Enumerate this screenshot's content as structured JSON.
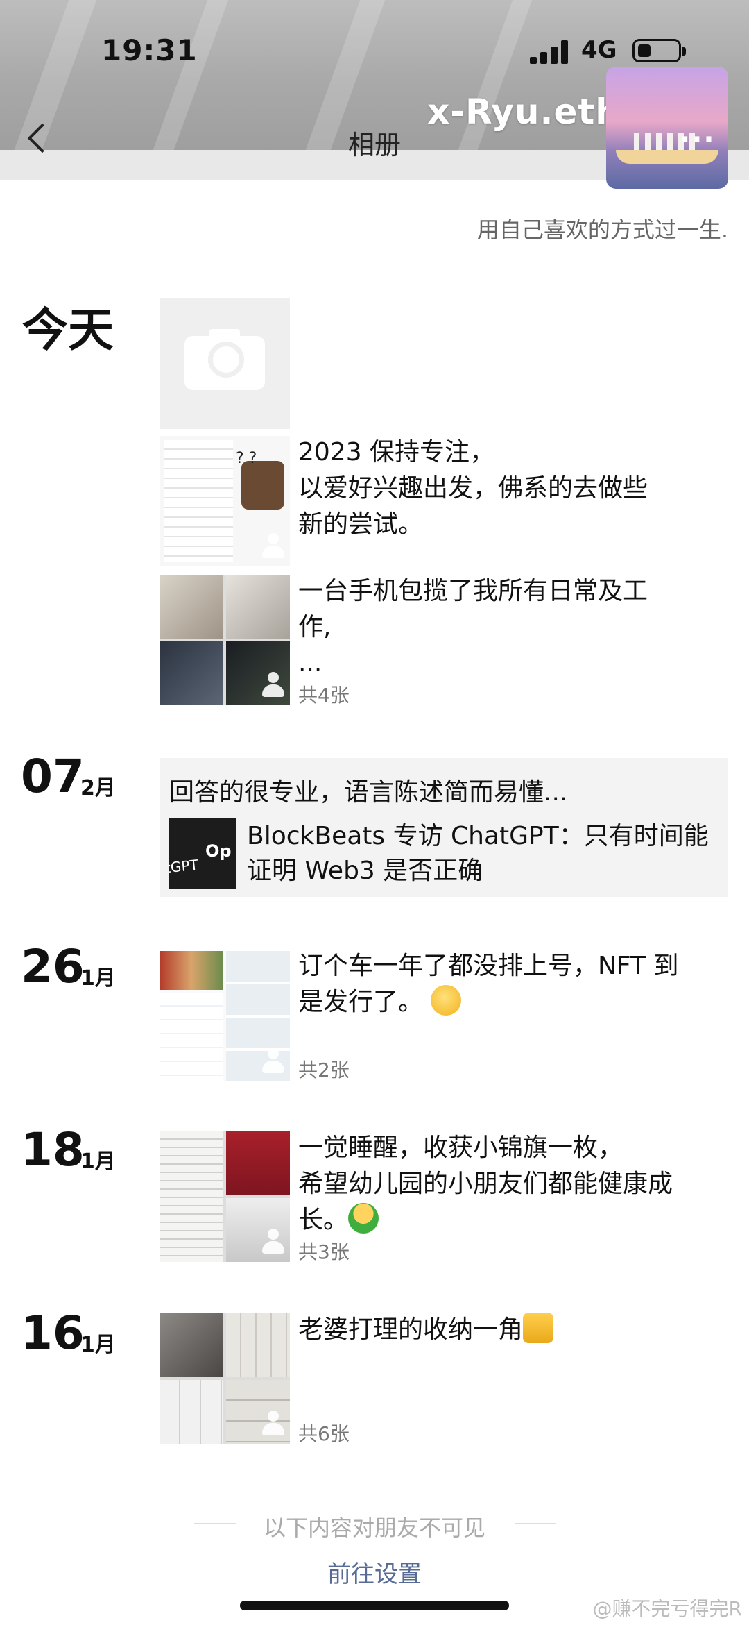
{
  "status_bar": {
    "time": "19:31",
    "network": "4G"
  },
  "nav": {
    "title": "相册",
    "username": "x-Ryu.eth",
    "more": "···"
  },
  "profile": {
    "signature": "用自己喜欢的方式过一生."
  },
  "feed": {
    "today": {
      "label": "今天",
      "post1_text": "2023 保持专注，\n以爱好兴趣出发，佛系的去做些\n新的尝试。",
      "post2_text": "一台手机包揽了我所有日常及工\n作,\n...",
      "post2_count": "共4张"
    },
    "feb07": {
      "day": "07",
      "month": "2月",
      "comment": "回答的很专业，语言陈述简而易懂...",
      "share_title": "BlockBeats 专访 ChatGPT：只有时间能证明 Web3 是否正确",
      "thumb_text_a": "tGPT",
      "thumb_text_b": "Op"
    },
    "jan26": {
      "day": "26",
      "month": "1月",
      "text": "订个车一年了都没排上号，NFT 到\n是发行了。",
      "count": "共2张"
    },
    "jan18": {
      "day": "18",
      "month": "1月",
      "text": "一觉睡醒，收获小锦旗一枚，\n希望幼儿园的小朋友们都能健康成\n长。",
      "count": "共3张"
    },
    "jan16": {
      "day": "16",
      "month": "1月",
      "text": "老婆打理的收纳一角",
      "count": "共6张"
    }
  },
  "footer": {
    "notice": "以下内容对朋友不可见",
    "link": "前往设置",
    "watermark": "@赚不完亏得完R"
  },
  "colors": {
    "link": "#576b95",
    "count": "#777777",
    "card_bg": "#f3f3f3"
  }
}
